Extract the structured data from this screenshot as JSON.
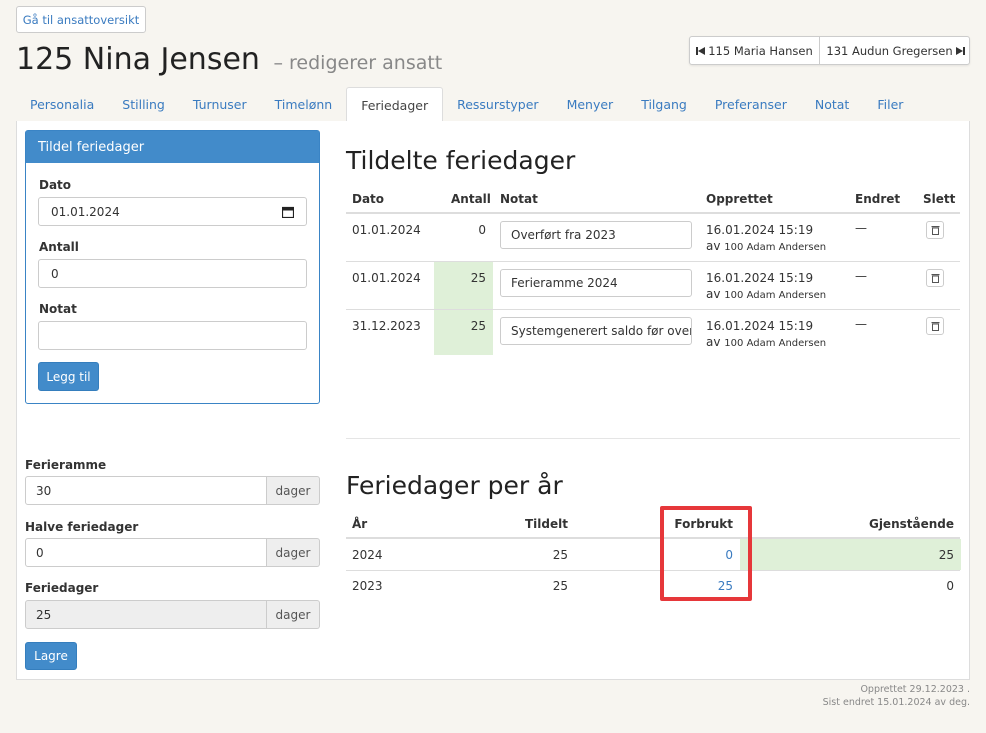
{
  "nav": {
    "back_label": "Gå til ansattoversikt",
    "prev_employee": "115 Maria Hansen",
    "next_employee": "131 Audun Gregersen"
  },
  "header": {
    "title": "125 Nina Jensen",
    "subtitle": "– redigerer ansatt"
  },
  "tabs": [
    {
      "label": "Personalia"
    },
    {
      "label": "Stilling"
    },
    {
      "label": "Turnuser"
    },
    {
      "label": "Timelønn"
    },
    {
      "label": "Feriedager",
      "active": true
    },
    {
      "label": "Ressurstyper"
    },
    {
      "label": "Menyer"
    },
    {
      "label": "Tilgang"
    },
    {
      "label": "Preferanser"
    },
    {
      "label": "Notat"
    },
    {
      "label": "Filer"
    }
  ],
  "assign_form": {
    "heading": "Tildel feriedager",
    "date_label": "Dato",
    "date_value": "01.01.2024",
    "count_label": "Antall",
    "count_value": "0",
    "note_label": "Notat",
    "note_value": "",
    "submit_label": "Legg til"
  },
  "settings_form": {
    "frame_label": "Ferieramme",
    "frame_value": "30",
    "half_label": "Halve feriedager",
    "half_value": "0",
    "days_label": "Feriedager",
    "days_value": "25",
    "unit": "dager",
    "save_label": "Lagre"
  },
  "assigned": {
    "heading": "Tildelte feriedager",
    "columns": [
      "Dato",
      "Antall",
      "Notat",
      "Opprettet",
      "Endret",
      "Slett"
    ],
    "by_prefix": "av",
    "rows": [
      {
        "date": "01.01.2024",
        "count": "0",
        "note": "Overført fra 2023",
        "created": "16.01.2024 15:19",
        "created_by": "100 Adam Andersen",
        "changed": "—"
      },
      {
        "date": "01.01.2024",
        "count": "25",
        "note": "Ferieramme 2024",
        "created": "16.01.2024 15:19",
        "created_by": "100 Adam Andersen",
        "changed": "—"
      },
      {
        "date": "31.12.2023",
        "count": "25",
        "note": "Systemgenerert saldo før overføring",
        "created": "16.01.2024 15:19",
        "created_by": "100 Adam Andersen",
        "changed": "—"
      }
    ]
  },
  "per_year": {
    "heading": "Feriedager per år",
    "columns": [
      "År",
      "Tildelt",
      "Forbrukt",
      "Gjenstående"
    ],
    "rows": [
      {
        "year": "2024",
        "assigned": "25",
        "used": "0",
        "remaining": "25"
      },
      {
        "year": "2023",
        "assigned": "25",
        "used": "25",
        "remaining": "0"
      }
    ]
  },
  "footer": {
    "created": "Opprettet 29.12.2023 .",
    "changed": "Sist endret 15.01.2024 av deg."
  },
  "colors": {
    "accent": "#428bca",
    "link": "#3a7bc0",
    "highlight_green": "#dff0d8",
    "annotation_red": "#e6373a"
  }
}
